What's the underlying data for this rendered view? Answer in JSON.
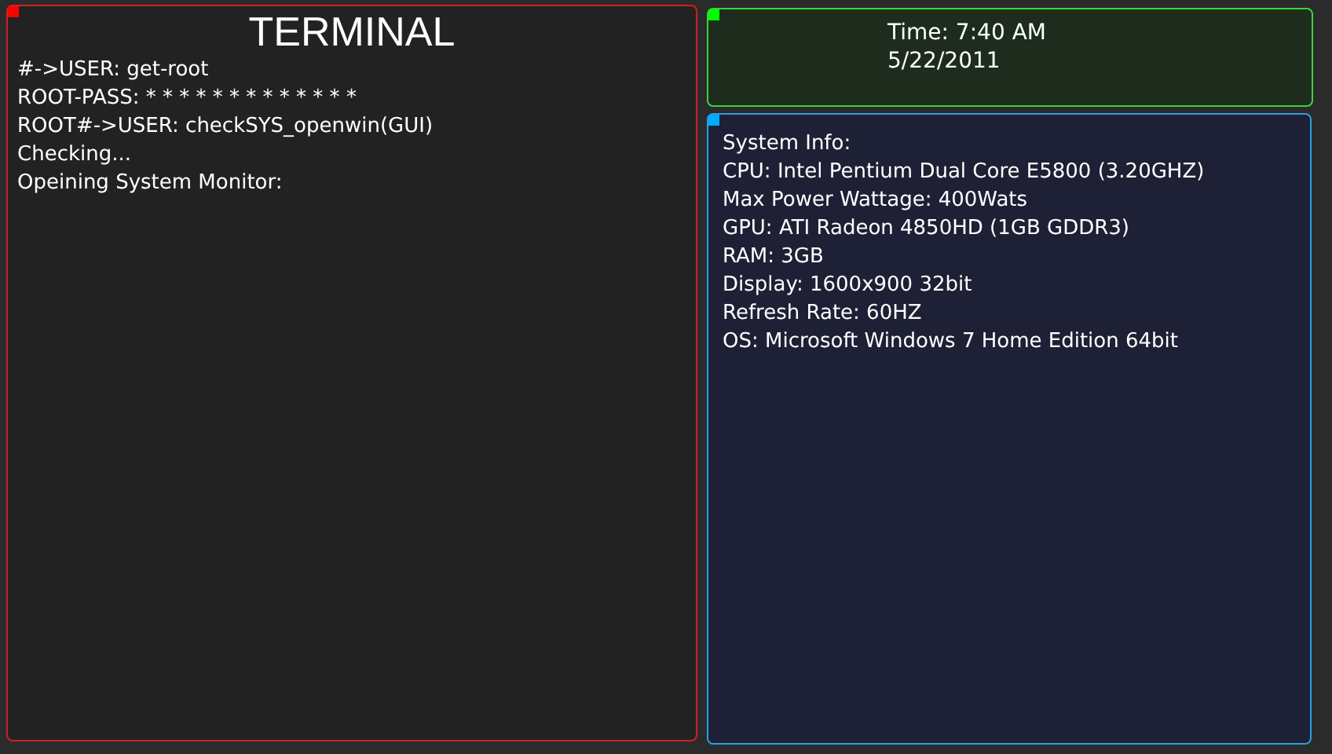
{
  "terminal": {
    "title": "TERMINAL",
    "lines": [
      "#->USER: get-root",
      "ROOT-PASS: * * * * * * * * * * * * *",
      "ROOT#->USER: checkSYS_openwin(GUI)",
      "Checking...",
      "Opeining System Monitor:"
    ]
  },
  "clock": {
    "time": "Time: 7:40 AM",
    "date": "5/22/2011"
  },
  "system_info": {
    "lines": [
      "System Info:",
      "CPU: Intel Pentium Dual Core E5800 (3.20GHZ)",
      "Max Power Wattage: 400Wats",
      "GPU: ATI Radeon 4850HD (1GB GDDR3)",
      "RAM: 3GB",
      "Display: 1600x900 32bit",
      "Refresh Rate: 60HZ",
      "OS: Microsoft Windows 7 Home Edition 64bit"
    ]
  }
}
